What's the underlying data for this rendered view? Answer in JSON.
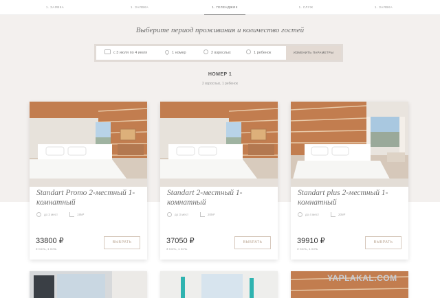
{
  "nav": {
    "steps": [
      {
        "label": "1. ЗАЯВКА"
      },
      {
        "label": "1. ЗАЯВКА"
      },
      {
        "label": "1. ГЕЛЕНДЖИК"
      },
      {
        "label": "1. СЛУЖ"
      },
      {
        "label": "1. ЗАЯВКА"
      }
    ],
    "active_index": 2
  },
  "search": {
    "heading": "Выберите период проживания и количество гостей",
    "dates": "с 3 июля по 4 июля",
    "rooms": "1 номер",
    "adults": "2 взрослых",
    "children": "1 ребенок",
    "change_label": "ИЗМЕНИТЬ ПАРАМЕТРЫ"
  },
  "room": {
    "title": "НОМЕР 1",
    "subtitle": "2 взрослых, 1 ребенок"
  },
  "offers": [
    {
      "name": "Standart Promo 2-местный 1-комнатный",
      "places": "до 3 мест",
      "area": "19М²",
      "price": "33800 ₽",
      "note": "3 гость, 1 ночь",
      "button": "ВЫБРАТЬ"
    },
    {
      "name": "Standart 2-местный 1-комнатный",
      "places": "до 3 мест",
      "area": "20М²",
      "price": "37050 ₽",
      "note": "3 гость, 1 ночь",
      "button": "ВЫБРАТЬ"
    },
    {
      "name": "Standart plus 2-местный 1-комнатный",
      "places": "до 4 мест",
      "area": "20М²",
      "price": "39910 ₽",
      "note": "3 гость, 1 ночь",
      "button": "ВЫБРАТЬ"
    }
  ],
  "watermark": "YAPLAKAL.COM",
  "colors": {
    "band_bg": "#f3f0ee",
    "button_bg": "#e3dad3",
    "button_border": "#d6c8bc",
    "wood": "#c27d4f"
  }
}
